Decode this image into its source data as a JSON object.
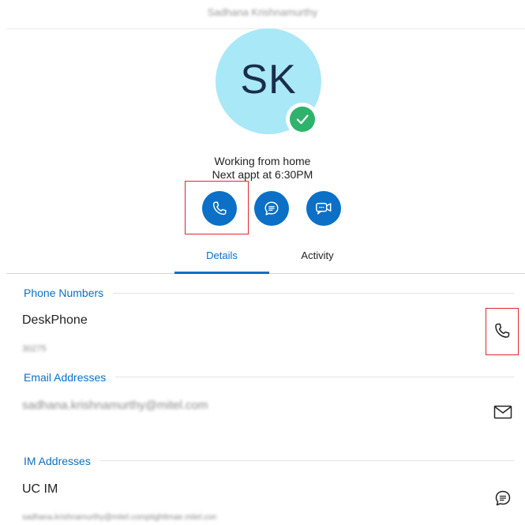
{
  "contact": {
    "name": "Sadhana Krishnamurthy",
    "initials": "SK",
    "status_line": "Working from home",
    "appointment_line": "Next appt at 6:30PM",
    "presence_color": "#2fb36b"
  },
  "actions": {
    "call_icon": "phone-icon",
    "chat_icon": "chat-icon",
    "video_icon": "video-icon"
  },
  "tabs": [
    {
      "label": "Details",
      "active": true
    },
    {
      "label": "Activity",
      "active": false
    }
  ],
  "sections": {
    "phone": {
      "title": "Phone Numbers",
      "items": [
        {
          "label": "DeskPhone",
          "value": "30275"
        }
      ]
    },
    "email": {
      "title": "Email Addresses",
      "items": [
        {
          "value": "sadhana.krishnamurthy@mitel.com"
        }
      ]
    },
    "im": {
      "title": "IM Addresses",
      "items": [
        {
          "label": "UC IM",
          "value": "sadhana.krishnamurthy@mitel.comptighttmae.mitel.con"
        }
      ]
    }
  },
  "colors": {
    "accent": "#0b70c6",
    "avatar_bg": "#a9e8f7",
    "highlight": "#e0262b"
  }
}
